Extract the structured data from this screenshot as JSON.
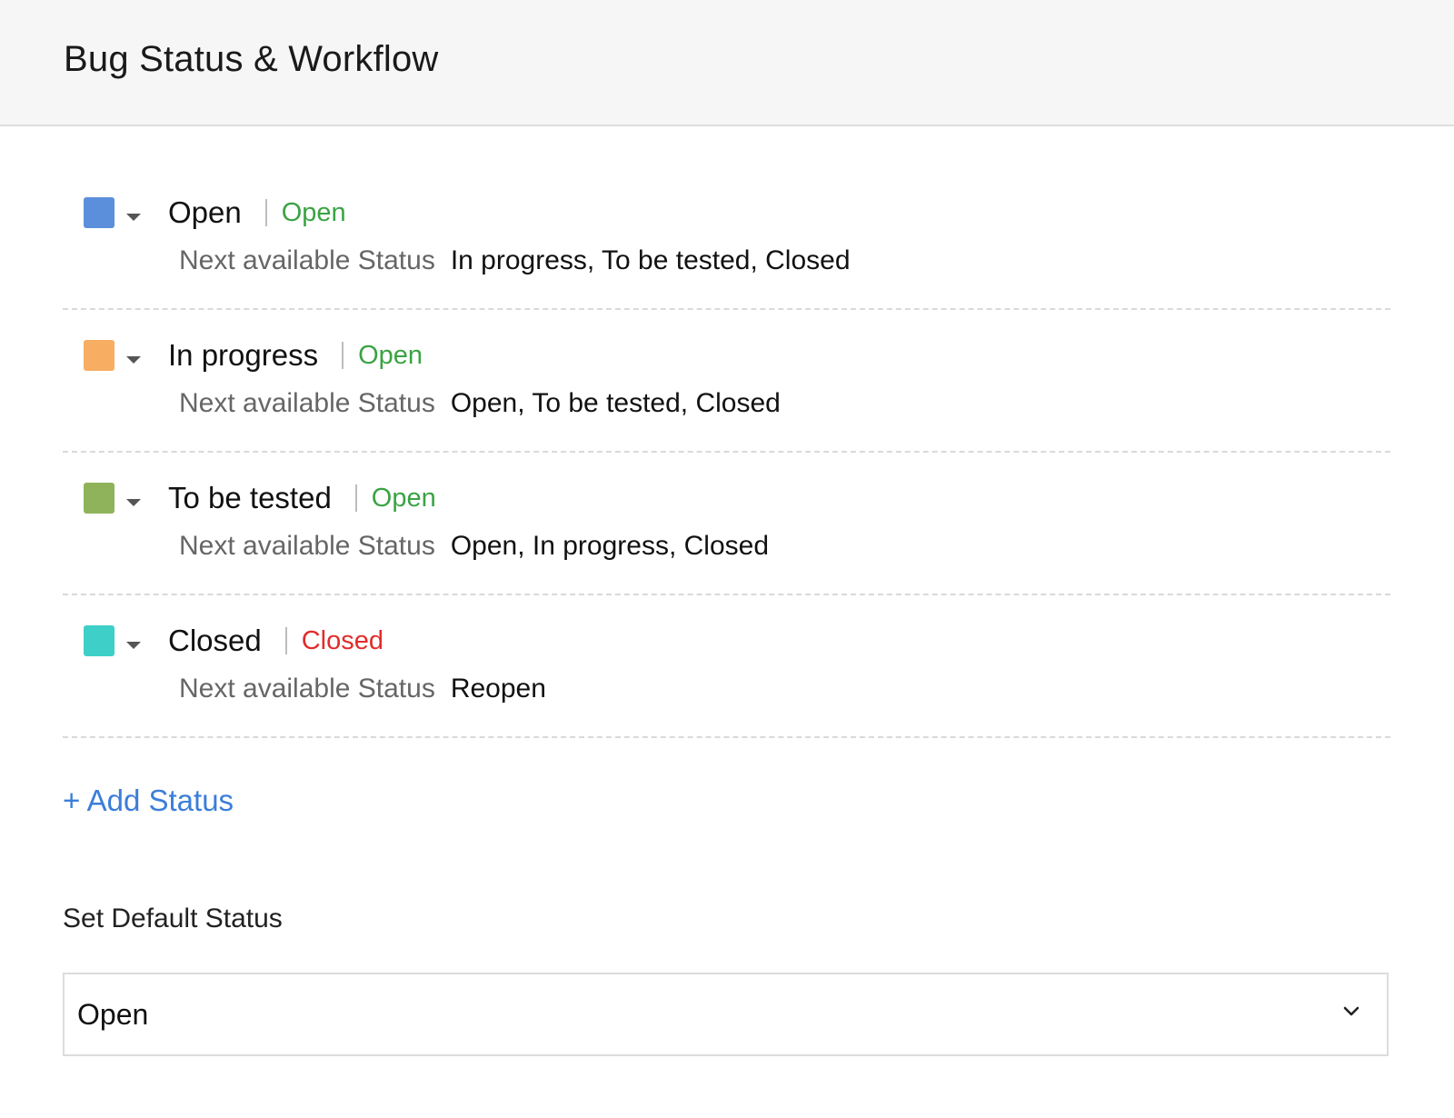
{
  "header": {
    "title": "Bug Status & Workflow"
  },
  "statuses": [
    {
      "name": "Open",
      "type": "Open",
      "type_color": "#3aa343",
      "swatch_color": "#5b8fdb",
      "next_label": "Next available Status",
      "next": "In progress, To be tested, Closed"
    },
    {
      "name": "In progress",
      "type": "Open",
      "type_color": "#3aa343",
      "swatch_color": "#f7ae62",
      "next_label": "Next available Status",
      "next": "Open, To be tested, Closed"
    },
    {
      "name": "To be tested",
      "type": "Open",
      "type_color": "#3aa343",
      "swatch_color": "#8fb35a",
      "next_label": "Next available Status",
      "next": "Open, In progress, Closed"
    },
    {
      "name": "Closed",
      "type": "Closed",
      "type_color": "#e32b2b",
      "swatch_color": "#3ecfc9",
      "next_label": "Next available Status",
      "next": "Reopen"
    }
  ],
  "add_status_label": "+ Add Status",
  "default_status": {
    "label": "Set Default Status",
    "selected": "Open"
  },
  "icons": {
    "row_dropdown": "caret-down-icon",
    "select_dropdown": "chevron-down-icon"
  }
}
